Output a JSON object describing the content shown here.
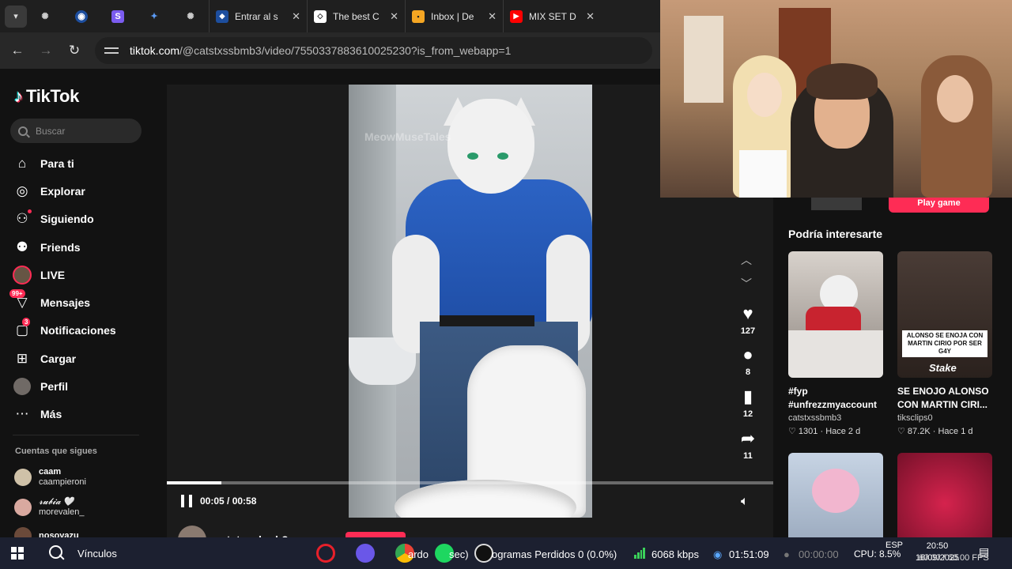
{
  "browser": {
    "tabs": [
      {
        "title": "Entrar al s",
        "favicon_color": "#1d4e9e",
        "favicon_glyph": "◆"
      },
      {
        "title": "The best C",
        "favicon_color": "#ffffff",
        "favicon_glyph": "◇"
      },
      {
        "title": "Inbox | De",
        "favicon_color": "#f5a623",
        "favicon_glyph": "▪"
      },
      {
        "title": "MIX SET D",
        "favicon_color": "#ff0000",
        "favicon_glyph": "▶"
      }
    ],
    "pinned_icons": [
      "chatgpt-icon",
      "globe-icon",
      "stripe-icon",
      "gemini-icon",
      "chatgpt-icon"
    ],
    "url_host": "tiktok.com",
    "url_path": "/@catstxssbmb3/video/7550337883610025230?is_from_webapp=1"
  },
  "tiktok": {
    "logo_text": "TikTok",
    "search_placeholder": "Buscar",
    "nav": [
      {
        "label": "Para ti",
        "icon": "home-icon"
      },
      {
        "label": "Explorar",
        "icon": "compass-icon"
      },
      {
        "label": "Siguiendo",
        "icon": "following-icon"
      },
      {
        "label": "Friends",
        "icon": "friends-icon"
      },
      {
        "label": "LIVE",
        "icon": "live-avatar"
      },
      {
        "label": "Mensajes",
        "icon": "messages-icon",
        "badge": "99+"
      },
      {
        "label": "Notificaciones",
        "icon": "notifications-icon",
        "badge": "3"
      },
      {
        "label": "Cargar",
        "icon": "upload-icon"
      },
      {
        "label": "Perfil",
        "icon": "profile-avatar"
      },
      {
        "label": "Más",
        "icon": "more-icon"
      }
    ],
    "following_header": "Cuentas que sigues",
    "following": [
      {
        "name": "caam",
        "handle": "caampieroni",
        "color": "#cfc1a8"
      },
      {
        "name": "𝓻𝓾𝓫𝓲𝓪 🤍",
        "handle": "morevalen_",
        "color": "#d9a9a0"
      },
      {
        "name": "nosoyazu",
        "handle": "",
        "color": "#6b4a3a"
      }
    ],
    "video": {
      "watermark": "MeowMuseTales",
      "current_time": "00:05",
      "duration": "00:58",
      "time_display": "00:05 / 00:58",
      "progress": 0.09,
      "creator": "catstxssbmb3"
    },
    "actions": {
      "likes": "127",
      "comments": "8",
      "saves": "12",
      "shares": "11"
    },
    "right": {
      "play_game": "Play game",
      "recommend_title": "Podría interesarte",
      "cards": [
        {
          "caption": "#fyp #unfrezzmyaccount",
          "author": "catstxssbmb3",
          "likes": "1301",
          "age": "Hace 2 d"
        },
        {
          "caption": "SE ENOJO ALONSO CON MARTIN CIRI...",
          "author": "tiksclips0",
          "likes": "87.2K",
          "age": "Hace 1 d",
          "thumb_text": "ALONSO SE ENOJA CON MARTIN CIRIO POR SER G4Y",
          "thumb_brand": "Stake"
        },
        {
          "caption": "",
          "author": "",
          "likes": "",
          "age": ""
        },
        {
          "caption": "",
          "author": "",
          "likes": "",
          "age": ""
        }
      ]
    }
  },
  "taskbar": {
    "vinculos": "Vínculos",
    "app1_text": "ardo",
    "app1_text2": "sec)",
    "lost_frames": "ogramas Perdidos 0 (0.0%)",
    "bitrate": "6068 kbps",
    "rec_time": "01:51:09",
    "stream_time": "00:00:00",
    "cpu": "CPU: 8.5%",
    "fps": "60.00 / 60.00 FPS",
    "lang": "ESP",
    "clock_time": "20:50",
    "clock_date": "16/09/2025"
  }
}
